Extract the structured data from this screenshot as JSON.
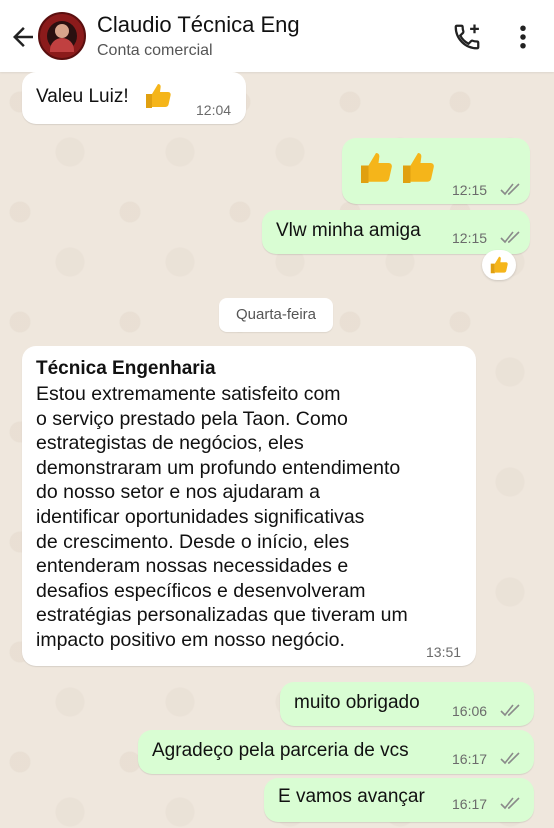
{
  "header": {
    "title": "Claudio Técnica Eng",
    "subtitle": "Conta comercial",
    "icons": [
      "back-arrow-icon",
      "avatar",
      "add-call-icon",
      "more-vert-icon"
    ]
  },
  "colors": {
    "incoming": "#ffffff",
    "outgoing": "#d9fdd3",
    "ticks": "#8a8a8a",
    "thumb": "#f5b51a"
  },
  "messages": {
    "m1": {
      "text": "Valeu Luiz!",
      "emoji": "thumbs-up",
      "time": "12:04"
    },
    "m2": {
      "emoji": "thumbs-up thumbs-up",
      "time": "12:15"
    },
    "m3": {
      "text": "Vlw minha amiga",
      "time": "12:15",
      "reaction": "thumbs-up"
    },
    "day_separator": "Quarta-feira",
    "m4": {
      "sender": "Técnica Engenharia",
      "lines": [
        "Estou extremamente satisfeito com",
        "o serviço prestado pela Taon. Como",
        "estrategistas de negócios, eles",
        "demonstraram um profundo entendimento",
        "do nosso setor e nos ajudaram a",
        "identificar oportunidades significativas",
        "de crescimento. Desde o início, eles",
        "entenderam nossas necessidades e",
        "desafios específicos e desenvolveram",
        "estratégias personalizadas que tiveram um",
        "impacto positivo em nosso negócio."
      ],
      "time": "13:51"
    },
    "m5": {
      "text": "muito obrigado",
      "time": "16:06"
    },
    "m6": {
      "text": "Agradeço pela parceria de vcs",
      "time": "16:17"
    },
    "m7": {
      "text": "E vamos avançar",
      "time": "16:17"
    }
  }
}
